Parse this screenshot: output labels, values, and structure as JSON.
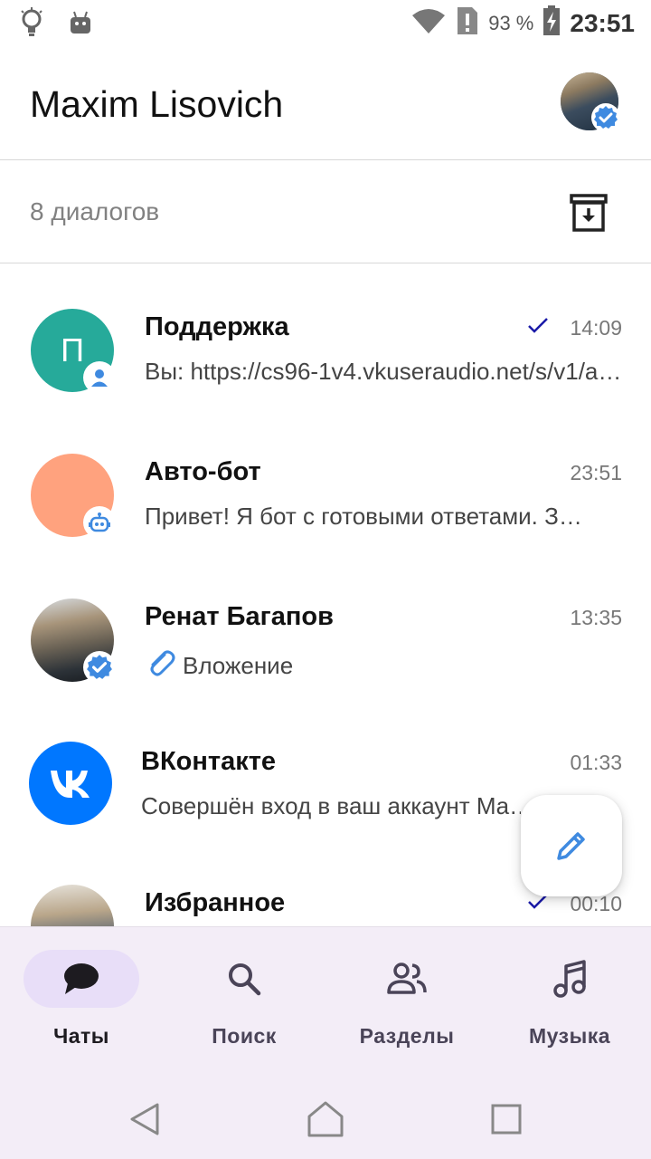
{
  "status_bar": {
    "battery_percent": "93 %",
    "time": "23:51"
  },
  "header": {
    "title": "Maxim Lisovich"
  },
  "subheader": {
    "dialogs_count": "8 диалогов"
  },
  "chats": [
    {
      "name": "Поддержка",
      "time": "14:09",
      "preview": "Вы: https://cs96-1v4.vkuseraudio.net/s/v1/ac/…",
      "avatar_letter": "П",
      "avatar_color": "#26aa9a",
      "read_check": true,
      "badge": "person-icon"
    },
    {
      "name": "Авто-бот",
      "time": "23:51",
      "preview": "Привет! Я бот с готовыми ответами. З…",
      "avatar_letter": "",
      "avatar_color": "#ffa27e",
      "badge": "bot-icon"
    },
    {
      "name": "Ренат Багапов",
      "time": "13:35",
      "preview": "Вложение",
      "badge": "verified-icon"
    },
    {
      "name": "ВКонтакте",
      "time": "01:33",
      "preview": "Совершён вход в ваш аккаунт Ma…",
      "avatar_color": "#0077ff"
    },
    {
      "name": "Избранное",
      "time": "00:10",
      "read_check": true
    }
  ],
  "bottom_nav": {
    "items": [
      {
        "label": "Чаты",
        "icon": "chat-bubble-icon",
        "active": true
      },
      {
        "label": "Поиск",
        "icon": "search-icon",
        "active": false
      },
      {
        "label": "Разделы",
        "icon": "people-icon",
        "active": false
      },
      {
        "label": "Музыка",
        "icon": "music-note-icon",
        "active": false
      }
    ]
  },
  "colors": {
    "accent": "#0077ff",
    "nav_background": "#f3edf7",
    "nav_active_pill": "#e8def8",
    "check_color": "#1a1aa8"
  }
}
